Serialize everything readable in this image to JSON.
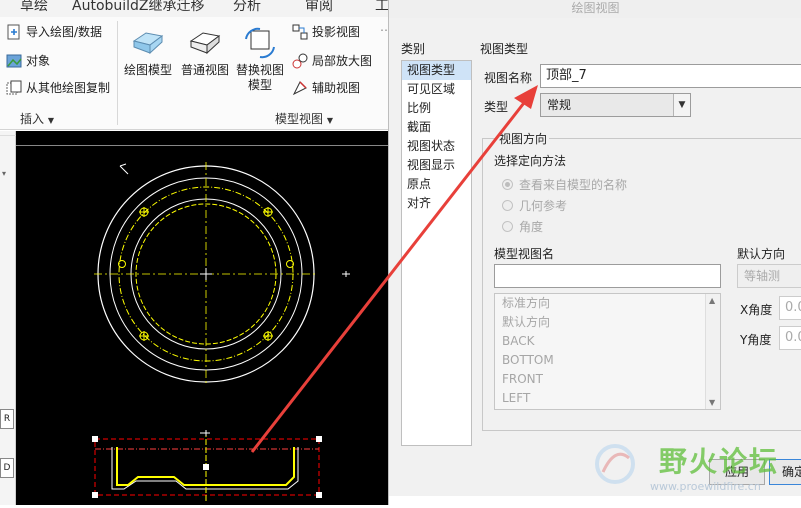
{
  "ribbon": {
    "tabs": [
      "草绘",
      "AutobuildZ继承迁移",
      "分析",
      "审阅",
      "工"
    ],
    "insert_group": {
      "items": [
        "导入绘图/数据",
        "对象",
        "从其他绘图复制"
      ],
      "label": "插入"
    },
    "model_view_group": {
      "big_buttons": [
        "绘图模型",
        "普通视图",
        "替换视图模型"
      ],
      "small_buttons": [
        "投影视图",
        "局部放大图",
        "辅助视图"
      ],
      "label": "模型视图"
    }
  },
  "left_strip": {
    "glyphs": [
      "R",
      "D"
    ]
  },
  "dialog": {
    "title": "绘图视图",
    "category_label": "类别",
    "categories": [
      "视图类型",
      "可见区域",
      "比例",
      "截面",
      "视图状态",
      "视图显示",
      "原点",
      "对齐"
    ],
    "selected_category": "视图类型",
    "section_title": "视图类型",
    "view_name_label": "视图名称",
    "view_name_value": "顶部_7",
    "type_label": "类型",
    "type_value": "常规",
    "orientation_group_title": "视图方向",
    "orientation_method_label": "选择定向方法",
    "orientation_options": [
      "查看来自模型的名称",
      "几何参考",
      "角度"
    ],
    "model_view_names_label": "模型视图名",
    "model_view_names_input": "",
    "model_view_names": [
      "标准方向",
      "默认方向",
      "BACK",
      "BOTTOM",
      "FRONT",
      "LEFT"
    ],
    "default_orientation_label": "默认方向",
    "default_orientation_value": "等轴测",
    "x_angle_label": "X角度",
    "x_angle_value": "0.0",
    "y_angle_label": "Y角度",
    "y_angle_value": "0.0",
    "apply_button": "应用",
    "ok_button": "确定"
  },
  "watermark": {
    "title": "野火论坛",
    "url": "www.proewildfire.cn"
  },
  "colors": {
    "canvas_bg": "#000000",
    "drawing_white": "#ffffff",
    "drawing_yellow": "#ffff00",
    "frame_red": "#ff0000",
    "annotation_arrow": "#e8403a",
    "selected_category_bg": "#cfe3f7",
    "watermark_green": "#5fbf3a"
  }
}
